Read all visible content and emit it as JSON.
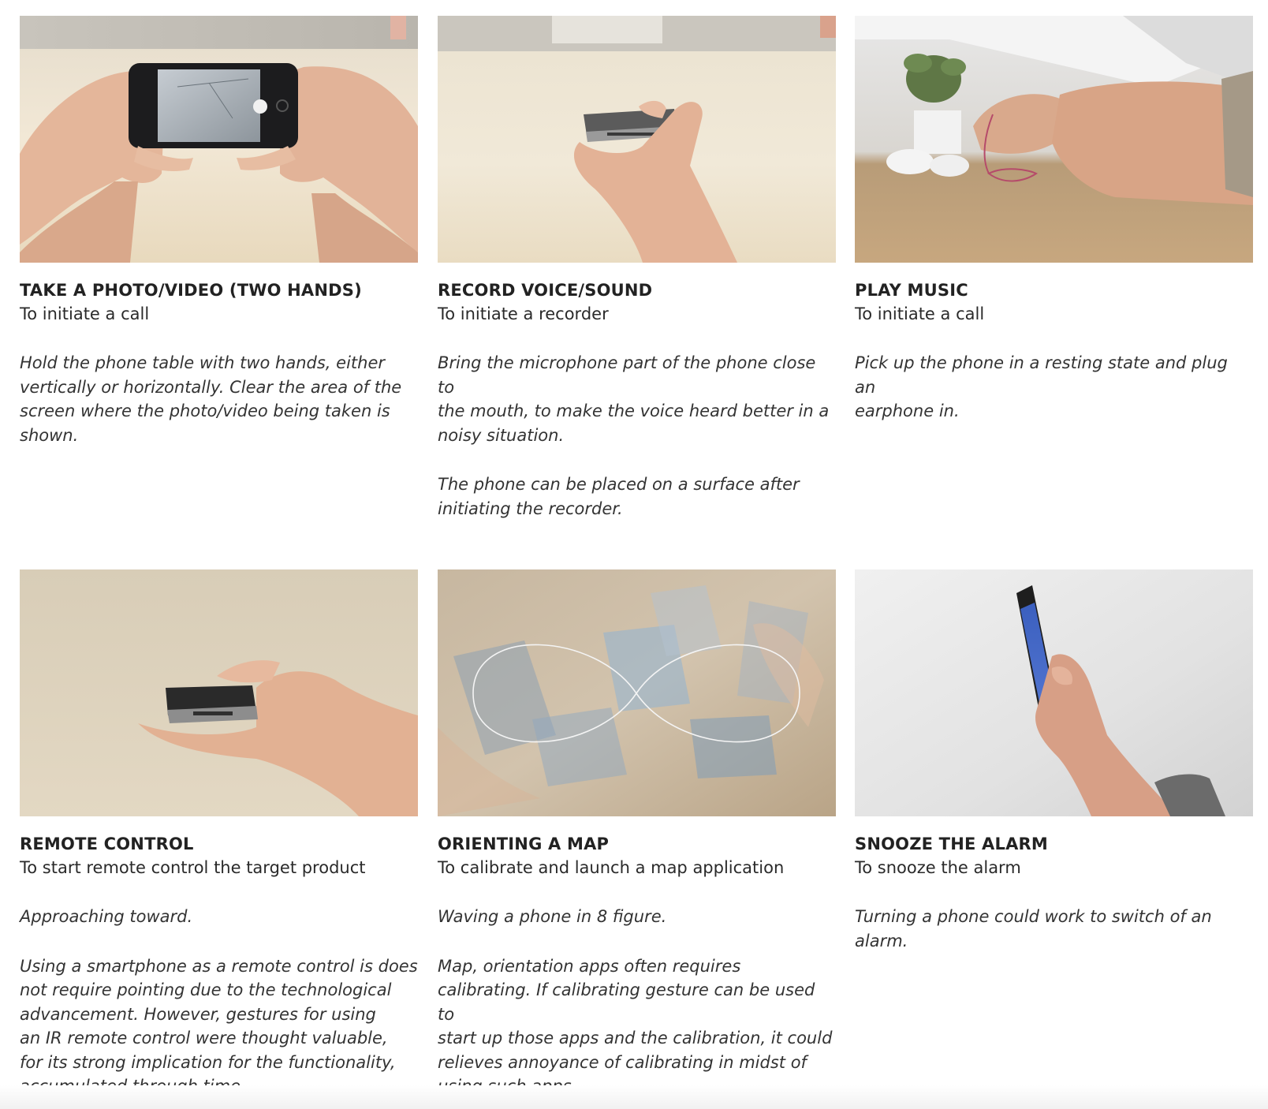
{
  "cards": [
    {
      "title": "TAKE A PHOTO/VIDEO (TWO HANDS)",
      "subtitle": "To initiate a call",
      "paragraphs": [
        "Hold the phone table with two hands, either\nvertically or horizontally. Clear the area of the\nscreen where the photo/video being taken is\nshown."
      ]
    },
    {
      "title": "RECORD VOICE/SOUND",
      "subtitle": "To initiate a recorder",
      "paragraphs": [
        "Bring the microphone part of the phone close to\nthe mouth, to make the voice heard better in a\nnoisy situation.",
        "The phone can be placed on a surface after\ninitiating the recorder."
      ]
    },
    {
      "title": "PLAY MUSIC",
      "subtitle": "To initiate a call",
      "paragraphs": [
        "Pick up the phone in a resting state and plug an\nearphone in."
      ]
    },
    {
      "title": "REMOTE CONTROL",
      "subtitle": "To start remote control the target product",
      "paragraphs": [
        "Approaching toward.",
        "Using a smartphone as a remote control is does\nnot require pointing due to the technological\nadvancement. However, gestures for using\nan IR remote control were thought valuable,\nfor its strong implication for the functionality,\naccumulated through time."
      ]
    },
    {
      "title": "ORIENTING A MAP",
      "subtitle": "To calibrate and launch a map application",
      "paragraphs": [
        "Waving a phone in 8 figure.",
        "Map, orientation apps often requires\ncalibrating. If calibrating gesture can be used to\nstart up those apps and the calibration,  it could\nrelieves annoyance of calibrating in midst of\nusing such apps."
      ]
    },
    {
      "title": "SNOOZE THE ALARM",
      "subtitle": "To snooze the alarm",
      "paragraphs": [
        "Turning a phone could work to switch of an\nalarm."
      ]
    }
  ]
}
